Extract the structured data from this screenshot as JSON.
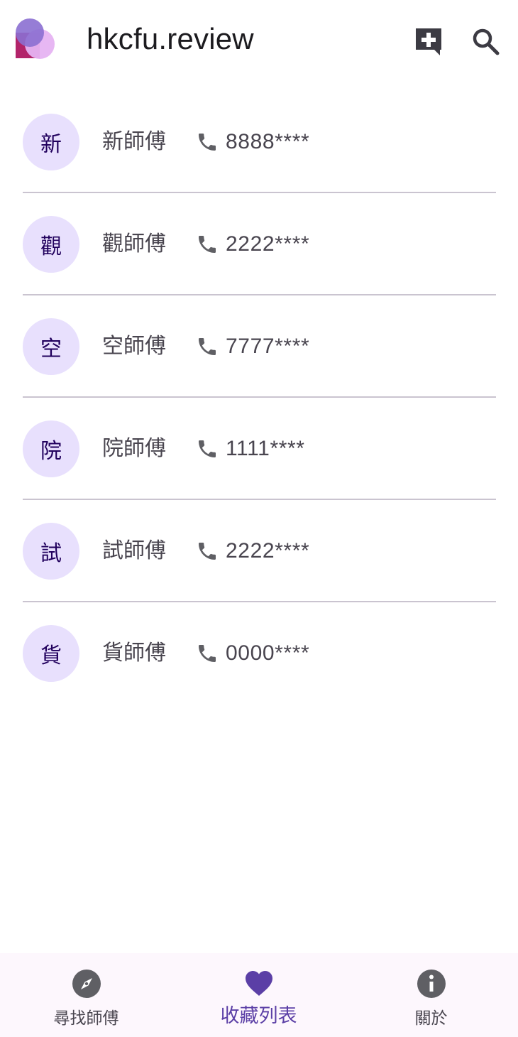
{
  "app": {
    "title": "hkcfu.review",
    "add_icon": "add-comment-icon",
    "search_icon": "search-icon"
  },
  "masters": [
    {
      "avatar": "新",
      "name": "新師傅",
      "phone": "8888****"
    },
    {
      "avatar": "觀",
      "name": "觀師傅",
      "phone": "2222****"
    },
    {
      "avatar": "空",
      "name": "空師傅",
      "phone": "7777****"
    },
    {
      "avatar": "院",
      "name": "院師傅",
      "phone": "1111****"
    },
    {
      "avatar": "試",
      "name": "試師傅",
      "phone": "2222****"
    },
    {
      "avatar": "貨",
      "name": "貨師傅",
      "phone": "0000****"
    }
  ],
  "bottom_nav": {
    "items": [
      {
        "label": "尋找師傅",
        "icon": "compass-icon",
        "active": false
      },
      {
        "label": "收藏列表",
        "icon": "heart-icon",
        "active": true
      },
      {
        "label": "關於",
        "icon": "info-icon",
        "active": false
      }
    ]
  },
  "colors": {
    "accent": "#5b3fa6",
    "avatar_bg": "#e8e0fd",
    "icon_gray": "#5f5f64",
    "nav_bg": "#fdf7fd"
  }
}
